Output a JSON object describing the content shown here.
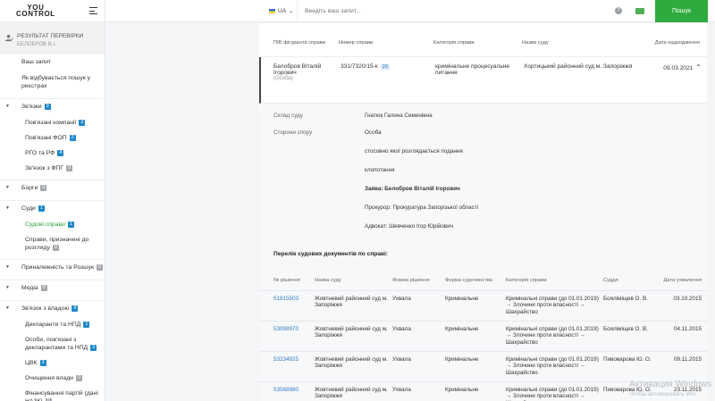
{
  "app": {
    "logo_line1": "YOU",
    "logo_line2": "CONTROL"
  },
  "sidebar": {
    "check_title": "РЕЗУЛЬТАТ ПЕРЕВІРКИ",
    "check_name": "БЕЛОБРОВ В.І.",
    "items": [
      {
        "label": "Ваш запит",
        "kind": "top"
      },
      {
        "label": "Як відбувається пошук у реєстрах",
        "kind": "top"
      },
      {
        "label": "Зв'язки",
        "kind": "group",
        "badge": "9",
        "badge_color": "blue"
      },
      {
        "label": "Пов'язані компанії",
        "kind": "sub",
        "badge": "3",
        "badge_color": "blue"
      },
      {
        "label": "Пов'язані ФОП",
        "kind": "sub",
        "badge": "2",
        "badge_color": "blue"
      },
      {
        "label": "РГО та РФ",
        "kind": "sub",
        "badge": "4",
        "badge_color": "blue"
      },
      {
        "label": "Зв'язок з ФПГ",
        "kind": "sub",
        "badge": "0",
        "badge_color": "grey"
      },
      {
        "label": "Борги",
        "kind": "group",
        "badge": "0",
        "badge_color": "grey"
      },
      {
        "label": "Суди",
        "kind": "group",
        "badge": "1",
        "badge_color": "blue"
      },
      {
        "label": "Судові справи",
        "kind": "sub",
        "badge": "1",
        "badge_color": "blue",
        "active": true
      },
      {
        "label": "Справи, призначені до розгляду",
        "kind": "sub",
        "badge": "0",
        "badge_color": "grey"
      },
      {
        "label": "Приналежність та Розшук",
        "kind": "group",
        "badge": "0",
        "badge_color": "grey"
      },
      {
        "label": "Медіа",
        "kind": "group",
        "badge": "0",
        "badge_color": "grey"
      },
      {
        "label": "Зв'язок з владою",
        "kind": "group",
        "badge": "9",
        "badge_color": "blue"
      },
      {
        "label": "Декларанти та НПД",
        "kind": "sub",
        "badge": "1",
        "badge_color": "blue"
      },
      {
        "label": "Особи, пов'язані з декларантами та НПД",
        "kind": "sub",
        "badge": "3",
        "badge_color": "blue"
      },
      {
        "label": "ЦВК",
        "kind": "sub",
        "badge": "3",
        "badge_color": "blue"
      },
      {
        "label": "Очищення влади",
        "kind": "sub",
        "badge": "0",
        "badge_color": "grey"
      },
      {
        "label": "Фінансування партій (дані НАЗК)",
        "kind": "sub",
        "badge": "0",
        "badge_color": "grey"
      }
    ]
  },
  "topbar": {
    "lang": "UA",
    "search_placeholder": "Введіть ваш запит...",
    "help": "?",
    "search_button": "Пошук"
  },
  "case_table": {
    "headers": [
      "ПІБ фігуранта справи",
      "Номер справи",
      "Категорія справи",
      "Назва суду",
      "Дата надходження"
    ],
    "row": {
      "name": "Белобров Віталій Ігорович",
      "role": "(Особа)",
      "number": "331/7320/15-к",
      "number_badge": "23",
      "category": "кримінальне процесуальне питання",
      "court": "Хортицький районний суд м. Запоріжжя",
      "date": "09.03.2021"
    }
  },
  "details": {
    "judge_label": "Склад суду",
    "judge_value": "Гнатюк Галина Семенівна",
    "parties_label": "Сторони спору",
    "parties": [
      "Особа",
      "стосовно якої розглядається подання",
      "клопотання",
      "Заява: Белобров Віталій Ігорович",
      "Прокурор: Прокуратура Запорізької області",
      "Адвокат: Шевченко Ігор Юрійович"
    ],
    "docs_title": "Перелік судових документів по справі:"
  },
  "docs": {
    "headers": [
      "№ рішення",
      "Назва суду",
      "Форма рішення",
      "Форма судочинства",
      "Категорія справи",
      "Суддя",
      "Дата ухвалення"
    ],
    "rows": [
      [
        "51815503",
        "Жовтневий районний суд м. Запоріжжя",
        "Ухвала",
        "Кримінальне",
        "Кримінальні справи (до 01.01.2019) → Злочини проти власності → Шахрайство",
        "Бояліміщев О. В.",
        "03.10.2015"
      ],
      [
        "53099970",
        "Жовтневий районний суд м. Запоріжжя",
        "Ухвала",
        "Кримінальне",
        "Кримінальні справи (до 01.01.2019) → Злочини проти власності → Шахрайство",
        "Бояліміщев О. В.",
        "04.11.2015"
      ],
      [
        "53234925",
        "Жовтневий районний суд м. Запоріжжя",
        "Ухвала",
        "Кримінальне",
        "Кримінальні справи (до 01.01.2019) → Злочини проти власності → Шахрайство",
        "Пивоварова Ю. О.",
        "09.11.2015"
      ],
      [
        "53568980",
        "Жовтневий районний суд м. Запоріжжя",
        "Ухвала",
        "Кримінальне",
        "Кримінальні справи (до 01.01.2019) → Злочини проти власності → Шахрайство",
        "Пивоварова Ю. О.",
        "23.11.2015"
      ]
    ]
  },
  "watermark": {
    "line1": "Активация Windows",
    "line2": "Чтобы активировать Win"
  },
  "colors": {
    "accent": "#2eab3e",
    "badge_blue": "#1e88c9",
    "badge_grey": "#a5a8ad",
    "link": "#2b7bc2"
  }
}
